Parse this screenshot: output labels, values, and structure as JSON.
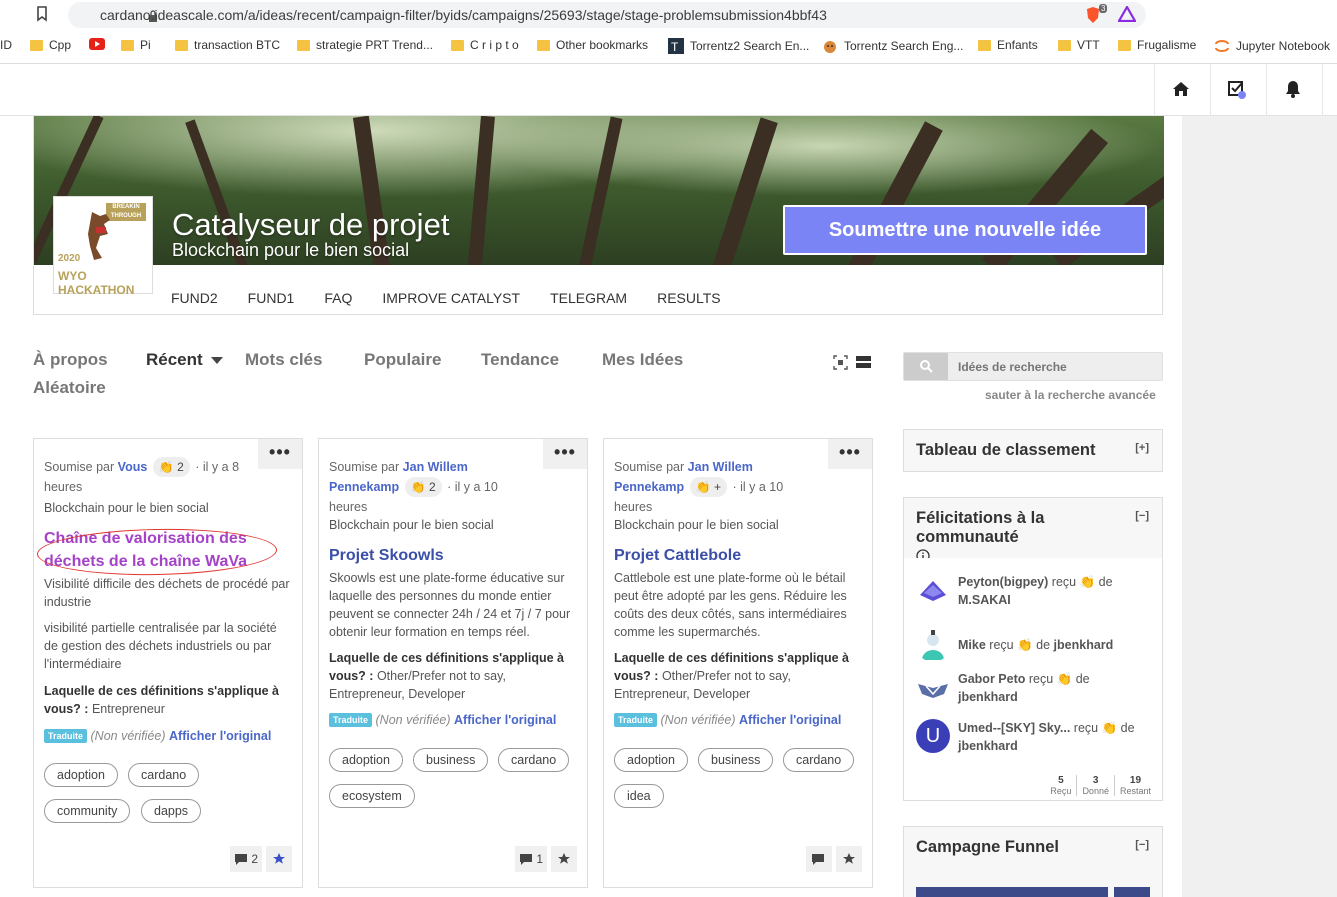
{
  "browser": {
    "url": "cardano.ideascale.com/a/ideas/recent/campaign-filter/byids/campaigns/25693/stage/stage-problemsubmission4bbf43",
    "brave_count": "3",
    "bookmarks": [
      {
        "label": "ID",
        "type": "text"
      },
      {
        "label": "Cpp",
        "type": "folder"
      },
      {
        "label": "",
        "type": "youtube"
      },
      {
        "label": "Pi",
        "type": "folder"
      },
      {
        "label": "transaction BTC",
        "type": "folder"
      },
      {
        "label": "strategie PRT Trend...",
        "type": "folder"
      },
      {
        "label": "C r i p t o",
        "type": "folder"
      },
      {
        "label": "Other bookmarks",
        "type": "folder"
      },
      {
        "label": "Torrentz2 Search En...",
        "type": "site"
      },
      {
        "label": "Torrentz Search Eng...",
        "type": "site"
      },
      {
        "label": "Enfants",
        "type": "folder"
      },
      {
        "label": "VTT",
        "type": "folder"
      },
      {
        "label": "Frugalisme",
        "type": "folder"
      },
      {
        "label": "Jupyter Notebook",
        "type": "site"
      }
    ]
  },
  "banner": {
    "title": "Catalyseur de projet",
    "subtitle": "Blockchain pour le bien social",
    "submit_label": "Soumettre une nouvelle idée",
    "nav": [
      "FUND2",
      "FUND1",
      "FAQ",
      "IMPROVE CATALYST",
      "TELEGRAM",
      "RESULTS"
    ],
    "logo_text": {
      "top": "BREAKIN THROUGH",
      "bottom": "WYO HACKATHON",
      "year": "2020"
    }
  },
  "tabs": [
    {
      "label": "À propos",
      "active": false
    },
    {
      "label": "Récent",
      "active": true
    },
    {
      "label": "Mots clés",
      "active": false
    },
    {
      "label": "Populaire",
      "active": false
    },
    {
      "label": "Tendance",
      "active": false
    },
    {
      "label": "Mes Idées",
      "active": false
    },
    {
      "label": "Aléatoire",
      "active": false
    }
  ],
  "search": {
    "placeholder": "Idées de recherche",
    "advanced_label": "sauter à la recherche avancée"
  },
  "cards": [
    {
      "submitted_by": "Soumise par",
      "author": "Vous",
      "claps": "2",
      "time": "· il y a 8 heures",
      "campaign": "Blockchain pour le bien social",
      "title": "Chaîne de valorisation des déchets de la chaîne WaVa",
      "desc1": "Visibilité difficile des déchets de procédé par industrie",
      "desc2": "visibilité partielle centralisée par la société de gestion des déchets industriels ou par l'intermédiaire",
      "q_label": "Laquelle de ces définitions s'applique à vous? :",
      "q_answer": "Entrepreneur",
      "badge": "Traduite",
      "not_verified": "(Non vérifiée)",
      "show_original": "Afficher l'original",
      "tags": [
        "adoption",
        "cardano",
        "community",
        "dapps"
      ],
      "comments": "2"
    },
    {
      "submitted_by": "Soumise par",
      "author": "Jan Willem Pennekamp",
      "claps": "2",
      "time": "· il y a 10 heures",
      "campaign": "Blockchain pour le bien social",
      "title": "Projet Skoowls",
      "desc1": "Skoowls est une plate-forme éducative sur laquelle des personnes du monde entier peuvent se connecter 24h / 24 et 7j / 7 pour obtenir leur formation en temps réel.",
      "q_label": "Laquelle de ces définitions s'applique à vous? :",
      "q_answer": "Other/Prefer not to say, Entrepreneur, Developer",
      "badge": "Traduite",
      "not_verified": "(Non vérifiée)",
      "show_original": "Afficher l'original",
      "tags": [
        "adoption",
        "business",
        "cardano",
        "ecosystem"
      ],
      "comments": "1"
    },
    {
      "submitted_by": "Soumise par",
      "author": "Jan Willem Pennekamp",
      "claps": "+",
      "time": "· il y a 10 heures",
      "campaign": "Blockchain pour le bien social",
      "title": "Projet Cattlebole",
      "desc1": "Cattlebole est une plate-forme où le bétail peut être adopté par les gens. Réduire les coûts des deux côtés, sans intermédiaires comme les supermarchés.",
      "q_label": "Laquelle de ces définitions s'applique à vous? :",
      "q_answer": "Other/Prefer not to say, Entrepreneur, Developer",
      "badge": "Traduite",
      "not_verified": "(Non vérifiée)",
      "show_original": "Afficher l'original",
      "tags": [
        "adoption",
        "business",
        "cardano",
        "idea"
      ],
      "comments": ""
    }
  ],
  "leaderboard": {
    "title": "Tableau de classement",
    "toggle": "[+]"
  },
  "community": {
    "title": "Félicitations à la communauté",
    "toggle": "[−]",
    "items": [
      {
        "who": "Peyton(bigpey)",
        "verb": "reçu",
        "from_word": "de",
        "from": "M.SAKAI",
        "avatar_color": "#5a4fd6"
      },
      {
        "who": "Mike",
        "verb": "reçu",
        "from_word": "de",
        "from": "jbenkhard",
        "avatar_color": "#3cc7b2"
      },
      {
        "who": "Gabor Peto",
        "verb": "reçu",
        "from_word": "de",
        "from": "jbenkhard",
        "avatar_color": "#5a6fa8"
      },
      {
        "who": "Umed--[SKY] Sky...",
        "verb": "reçu",
        "from_word": "de",
        "from": "jbenkhard",
        "avatar_color": "#3a3fb8",
        "initial": "U"
      }
    ],
    "stats": [
      {
        "value": "5",
        "label": "Reçu"
      },
      {
        "value": "3",
        "label": "Donné"
      },
      {
        "value": "19",
        "label": "Restant"
      }
    ]
  },
  "funnel": {
    "title": "Campagne Funnel",
    "toggle": "[−]"
  }
}
